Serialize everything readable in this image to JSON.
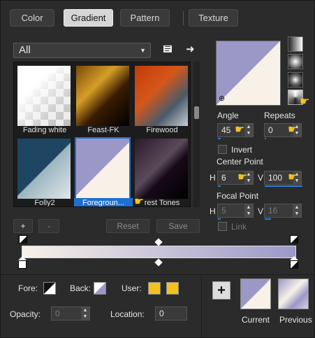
{
  "tabs": [
    {
      "label": "Color",
      "active": false
    },
    {
      "label": "Gradient",
      "active": true
    },
    {
      "label": "Pattern",
      "active": false
    },
    {
      "label": "Texture",
      "active": false
    }
  ],
  "library": {
    "category": "All",
    "items": [
      {
        "label": "Fading white"
      },
      {
        "label": "Feast-FK"
      },
      {
        "label": "Firewood"
      },
      {
        "label": "Folly2"
      },
      {
        "label": "Foregroun...",
        "selected": true
      },
      {
        "label": "rest Tones"
      }
    ]
  },
  "buttons": {
    "add": "+",
    "remove": "-",
    "reset": "Reset",
    "save": "Save"
  },
  "settings": {
    "angle_label": "Angle",
    "angle_value": "45",
    "repeats_label": "Repeats",
    "repeats_value": "0",
    "invert_label": "Invert",
    "center_point_label": "Center Point",
    "center_h_label": "H",
    "center_h_value": "6",
    "center_v_label": "V",
    "center_v_value": "100",
    "focal_point_label": "Focal Point",
    "focal_h_label": "H",
    "focal_h_value": "5",
    "focal_v_label": "V",
    "focal_v_value": "16",
    "link_label": "Link"
  },
  "colors": {
    "fore_label": "Fore:",
    "back_label": "Back:",
    "user_label": "User:",
    "opacity_label": "Opacity:",
    "opacity_value": "0",
    "location_label": "Location:",
    "location_value": "0",
    "foreground": "#9b98c8",
    "background": "#f8f1e8",
    "user_color": "#f4c21c"
  },
  "swatches": {
    "current_label": "Current",
    "previous_label": "Previous"
  }
}
